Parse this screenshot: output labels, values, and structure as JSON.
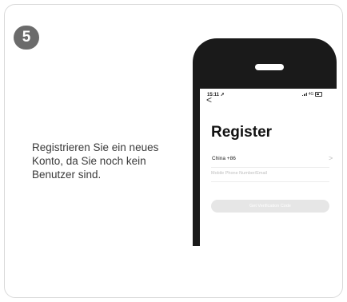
{
  "step": {
    "number": "5"
  },
  "description": {
    "lines": [
      "Registrieren Sie ein neues",
      "Konto, da Sie noch kein",
      "Benutzer sind."
    ]
  },
  "phone": {
    "status": {
      "time": "15:11",
      "network": "4G"
    },
    "screen": {
      "back_glyph": "<",
      "title": "Register",
      "country": "China +86",
      "country_chevron": ">",
      "phone_placeholder": "Mobile Phone Number/Email",
      "verify_button": "Get Verification Code"
    }
  },
  "colors": {
    "badge": "#6b6b6b",
    "card_border": "#d9d9d9",
    "phone_body": "#1a1a1a",
    "button_disabled": "#e6e6e6"
  }
}
